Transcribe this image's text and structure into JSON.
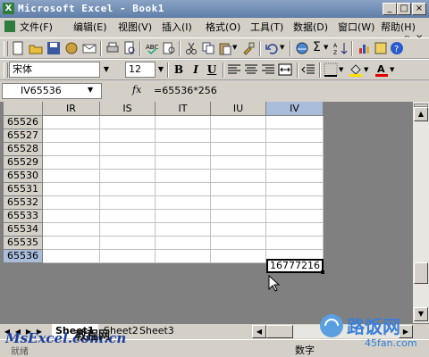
{
  "window": {
    "title": "Microsoft Excel - Book1",
    "app_icon": "excel-icon"
  },
  "menu": [
    {
      "label": "文件(F)"
    },
    {
      "label": "编辑(E)"
    },
    {
      "label": "视图(V)"
    },
    {
      "label": "插入(I)"
    },
    {
      "label": "格式(O)"
    },
    {
      "label": "工具(T)"
    },
    {
      "label": "数据(D)"
    },
    {
      "label": "窗口(W)"
    },
    {
      "label": "帮助(H)"
    }
  ],
  "format": {
    "font_name": "宋体",
    "font_size": "12",
    "bold": "B",
    "italic": "I",
    "underline": "U"
  },
  "formula": {
    "name_box": "IV65536",
    "fx": "fx",
    "content": "=65536*256"
  },
  "columns": [
    "IR",
    "IS",
    "IT",
    "IU",
    "IV"
  ],
  "rows": [
    "65526",
    "65527",
    "65528",
    "65529",
    "65530",
    "65531",
    "65532",
    "65533",
    "65534",
    "65535",
    "65536"
  ],
  "active_cell_value": "16777216",
  "sheets": [
    "Sheet1",
    "Sheet2",
    "Sheet3"
  ],
  "status": {
    "left": "就绪",
    "right": "数字"
  },
  "watermark": {
    "left": "MsExcel.com.cn",
    "left_cn": "教程网",
    "right_cn": "路饭网",
    "right_url": "45fan.com"
  },
  "colors": {
    "title_start": "#8aa3c4",
    "title_end": "#5f7ea8",
    "active_header": "#a9bcd9",
    "chrome": "#d4d0c8"
  }
}
